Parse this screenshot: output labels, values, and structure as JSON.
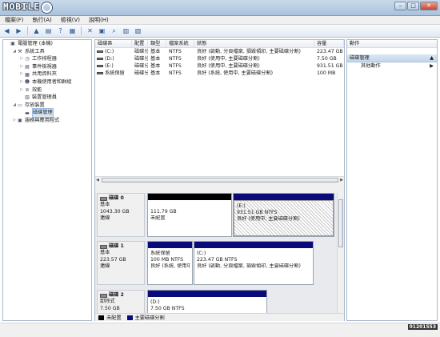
{
  "window": {
    "logo_text": "MOBILE",
    "logo_number": "01",
    "min": "–",
    "max": "□",
    "close": "✕"
  },
  "menu": [
    "檔案(F)",
    "執行(A)",
    "檢視(V)",
    "說明(H)"
  ],
  "tree": [
    {
      "label": "電腦管理 (本機)",
      "level": 0,
      "icon": "computer-management-icon",
      "glyph": "▣"
    },
    {
      "label": "系統工具",
      "level": 1,
      "icon": "tools-icon",
      "glyph": "⚒",
      "expander": "◢"
    },
    {
      "label": "工作排程器",
      "level": 2,
      "icon": "clock-icon",
      "glyph": "◷",
      "expander": "▷"
    },
    {
      "label": "事件檢視器",
      "level": 2,
      "icon": "event-viewer-icon",
      "glyph": "▤",
      "expander": "▷"
    },
    {
      "label": "共用資料夾",
      "level": 2,
      "icon": "shared-folder-icon",
      "glyph": "▦",
      "expander": "▷"
    },
    {
      "label": "本機使用者和群組",
      "level": 2,
      "icon": "users-icon",
      "glyph": "☻",
      "expander": "▷"
    },
    {
      "label": "效能",
      "level": 2,
      "icon": "performance-icon",
      "glyph": "⊘",
      "expander": "▷"
    },
    {
      "label": "裝置管理員",
      "level": 2,
      "icon": "device-manager-icon",
      "glyph": "▥"
    },
    {
      "label": "存放裝置",
      "level": 1,
      "icon": "storage-icon",
      "glyph": "▭",
      "expander": "◢"
    },
    {
      "label": "磁碟管理",
      "level": 2,
      "icon": "disk-management-icon",
      "glyph": "▬",
      "selected": true
    },
    {
      "label": "服務與應用程式",
      "level": 1,
      "icon": "services-icon",
      "glyph": "▣",
      "expander": "▷"
    }
  ],
  "volumes": {
    "headers": [
      "磁碟區",
      "配置",
      "類型",
      "檔案系統",
      "狀態",
      "容量"
    ],
    "rows": [
      [
        "(C:)",
        "磁碟分割",
        "基本",
        "NTFS",
        "良好 (啟動, 分頁檔案, 損毀傾印, 主要磁碟分割)",
        "223.47 GB"
      ],
      [
        "(D:)",
        "磁碟分割",
        "基本",
        "NTFS",
        "良好 (使用中, 主要磁碟分割)",
        "7.50 GB"
      ],
      [
        "(E:)",
        "磁碟分割",
        "基本",
        "NTFS",
        "良好 (使用中, 主要磁碟分割)",
        "931.51 GB"
      ],
      [
        "系統保留",
        "磁碟分割",
        "基本",
        "NTFS",
        "良好 (系統, 使用中, 主要磁碟分割)",
        "100 MB"
      ]
    ]
  },
  "disks": [
    {
      "name": "磁碟 0",
      "type": "基本",
      "size": "1043.30 GB",
      "status": "連線",
      "partitions": [
        {
          "l1": "",
          "l2": "111.79 GB",
          "l3": "未配置",
          "kind": "unallocated"
        },
        {
          "l1": "(E:)",
          "l2": "931.51 GB NTFS",
          "l3": "良好 (使用中, 主要磁碟分割)",
          "kind": "primary-selected"
        }
      ]
    },
    {
      "name": "磁碟 1",
      "type": "基本",
      "size": "223.57 GB",
      "status": "連線",
      "partitions": [
        {
          "l1": "系統保留",
          "l2": "100 MB NTFS",
          "l3": "良好 (系統, 使用中",
          "kind": "primary"
        },
        {
          "l1": "(C:)",
          "l2": "223.47 GB NTFS",
          "l3": "良好 (啟動, 分頁檔案, 損毀傾印, 主要磁碟分割)",
          "kind": "primary"
        }
      ]
    },
    {
      "name": "磁碟 2",
      "type": "卸除式",
      "size": "7.50 GB",
      "status": "",
      "partitions": [
        {
          "l1": "(D:)",
          "l2": "7.50 GB NTFS",
          "l3": "",
          "kind": "primary"
        }
      ]
    }
  ],
  "legend": [
    "未配置",
    "主要磁碟分割"
  ],
  "actions": {
    "header": "動作",
    "selected": "磁碟管理",
    "more": "其他動作",
    "arrow_up": "▲",
    "arrow_right": "▶"
  },
  "watermark": {
    "brand": "Bᴼ",
    "number": "01201553"
  },
  "colors": {
    "unallocated": "#000000",
    "primary": "#0a0a7a"
  }
}
